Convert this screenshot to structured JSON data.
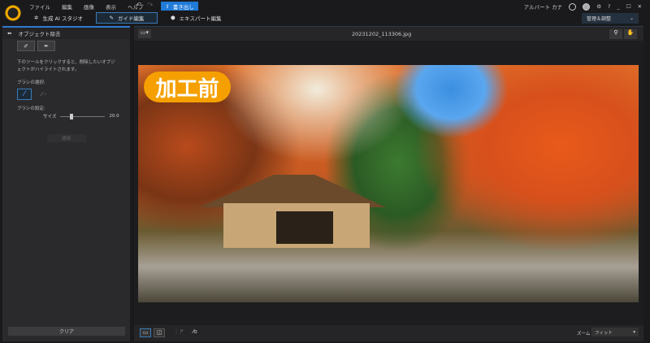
{
  "app": {
    "menu": [
      "ファイル",
      "編集",
      "画像",
      "表示",
      "ヘルプ"
    ],
    "export_label": "書き出し",
    "user_name": "アルバート カナ",
    "manage_label": "管理＆調整"
  },
  "tabs": [
    {
      "label": "生成 AI スタジオ",
      "icon": "sparkle-icon"
    },
    {
      "label": "ガイド編集",
      "icon": "magic-wand-icon",
      "active": true
    },
    {
      "label": "エキスパート編集",
      "icon": "cube-icon"
    }
  ],
  "panel": {
    "title": "オブジェクト除去",
    "description": "下のツールをクリックすると、削除したいオブジェクトがハイライトされます。",
    "brush_select_label": "ブラシの選択:",
    "brush_settings_label": "ブラシの設定:",
    "size_label": "サイズ",
    "size_value": "20.0",
    "size_fraction": 0.25,
    "apply_label": "適用",
    "clear_label": "クリア"
  },
  "viewer": {
    "filename": "20231202_113306.jpg",
    "badge": "加工前",
    "zoom_label": "ズーム",
    "zoom_value": "フィット"
  },
  "colors": {
    "accent": "#1f7ad8",
    "badge": "#f5a000"
  }
}
